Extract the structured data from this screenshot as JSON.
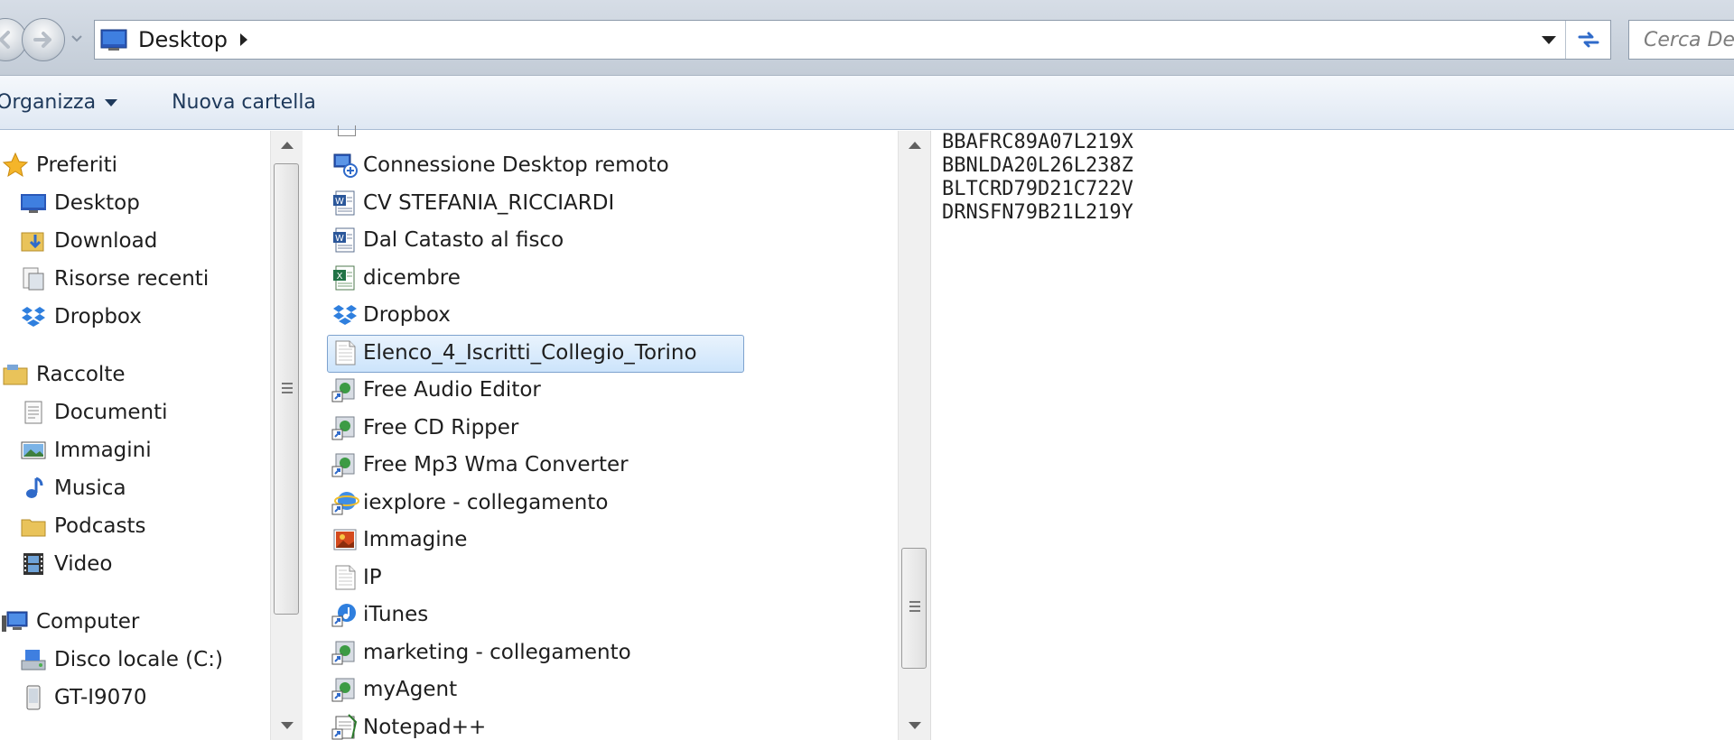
{
  "address_bar": {
    "location": "Desktop",
    "search_placeholder": "Cerca Desktop"
  },
  "command_bar": {
    "organize_label": "Organizza",
    "new_folder_label": "Nuova cartella"
  },
  "nav_pane": {
    "favorites_label": "Preferiti",
    "favorites": [
      "Desktop",
      "Download",
      "Risorse recenti",
      "Dropbox"
    ],
    "libraries_label": "Raccolte",
    "libraries": [
      "Documenti",
      "Immagini",
      "Musica",
      "Podcasts",
      "Video"
    ],
    "computer_label": "Computer",
    "computer": [
      "Disco locale (C:)",
      "GT-I9070"
    ]
  },
  "files": [
    {
      "name": "Connessione Desktop remoto",
      "icon": "remote-desktop-icon"
    },
    {
      "name": "CV STEFANIA_RICCIARDI",
      "icon": "word-document-icon"
    },
    {
      "name": "Dal Catasto al fisco",
      "icon": "word-document-icon"
    },
    {
      "name": "dicembre",
      "icon": "excel-document-icon"
    },
    {
      "name": "Dropbox",
      "icon": "dropbox-icon"
    },
    {
      "name": "Elenco_4_Iscritti_Collegio_Torino",
      "icon": "text-file-icon",
      "selected": true
    },
    {
      "name": "Free Audio Editor",
      "icon": "shortcut-icon"
    },
    {
      "name": "Free CD Ripper",
      "icon": "shortcut-icon"
    },
    {
      "name": "Free Mp3 Wma Converter",
      "icon": "shortcut-icon"
    },
    {
      "name": "iexplore - collegamento",
      "icon": "internet-explorer-icon"
    },
    {
      "name": "Immagine",
      "icon": "image-file-icon"
    },
    {
      "name": "IP",
      "icon": "text-file-icon"
    },
    {
      "name": "iTunes",
      "icon": "itunes-icon"
    },
    {
      "name": "marketing - collegamento",
      "icon": "shortcut-icon"
    },
    {
      "name": "myAgent",
      "icon": "shortcut-icon"
    },
    {
      "name": "Notepad++",
      "icon": "notepad-plus-icon"
    }
  ],
  "preview": {
    "lines": [
      "BBAFRC89A07L219X",
      "BBNLDA20L26L238Z",
      "BLTCRD79D21C722V",
      "DRNSFN79B21L219Y"
    ]
  },
  "colors": {
    "selection_fill": "#cce4fb",
    "selection_border": "#7da2ce",
    "command_text": "#1e395b"
  }
}
